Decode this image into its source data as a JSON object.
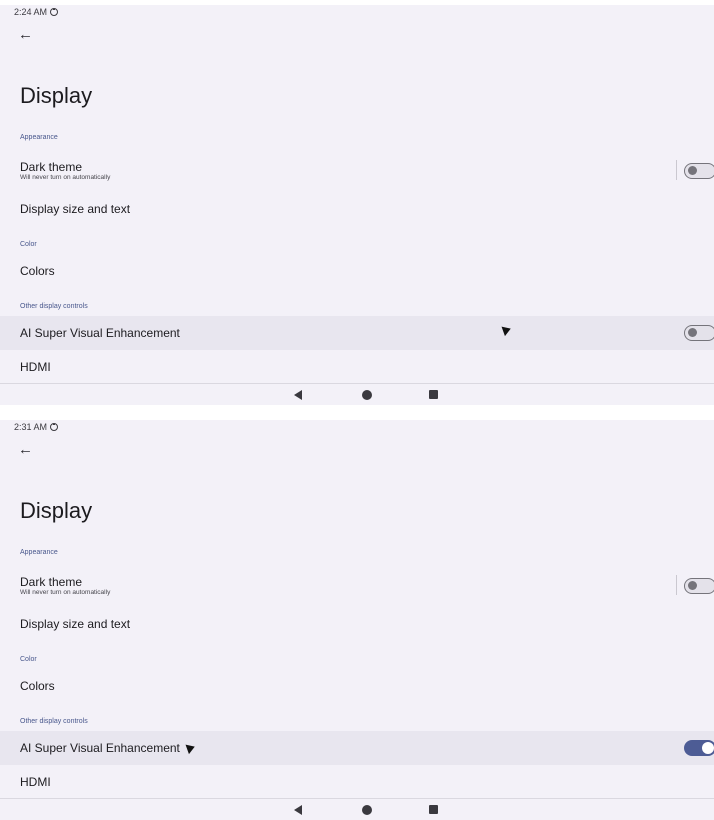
{
  "screens": [
    {
      "status": {
        "time": "2:24 AM"
      },
      "title": "Display",
      "sections": {
        "appearance": "Appearance",
        "color": "Color",
        "other": "Other display controls"
      },
      "rows": {
        "dark_theme": {
          "label": "Dark theme",
          "sub": "Will never turn on automatically",
          "toggle": "off"
        },
        "display_size": {
          "label": "Display size and text"
        },
        "colors": {
          "label": "Colors"
        },
        "ai_super": {
          "label": "AI Super Visual Enhancement",
          "toggle": "off"
        },
        "hdmi": {
          "label": "HDMI"
        }
      }
    },
    {
      "status": {
        "time": "2:31 AM"
      },
      "title": "Display",
      "sections": {
        "appearance": "Appearance",
        "color": "Color",
        "other": "Other display controls"
      },
      "rows": {
        "dark_theme": {
          "label": "Dark theme",
          "sub": "Will never turn on automatically",
          "toggle": "off"
        },
        "display_size": {
          "label": "Display size and text"
        },
        "colors": {
          "label": "Colors"
        },
        "ai_super": {
          "label": "AI Super Visual Enhancement",
          "toggle": "on"
        },
        "hdmi": {
          "label": "HDMI"
        }
      }
    }
  ],
  "icons": {
    "back": "arrow-left-icon",
    "status": "alarm-icon",
    "nav_back": "triangle-back-icon",
    "nav_home": "circle-home-icon",
    "nav_recent": "square-recents-icon"
  },
  "colors": {
    "background": "#f3f1f8",
    "accent": "#4d5c95",
    "section_label": "#48578c",
    "highlight_row": "#e8e6ef"
  }
}
